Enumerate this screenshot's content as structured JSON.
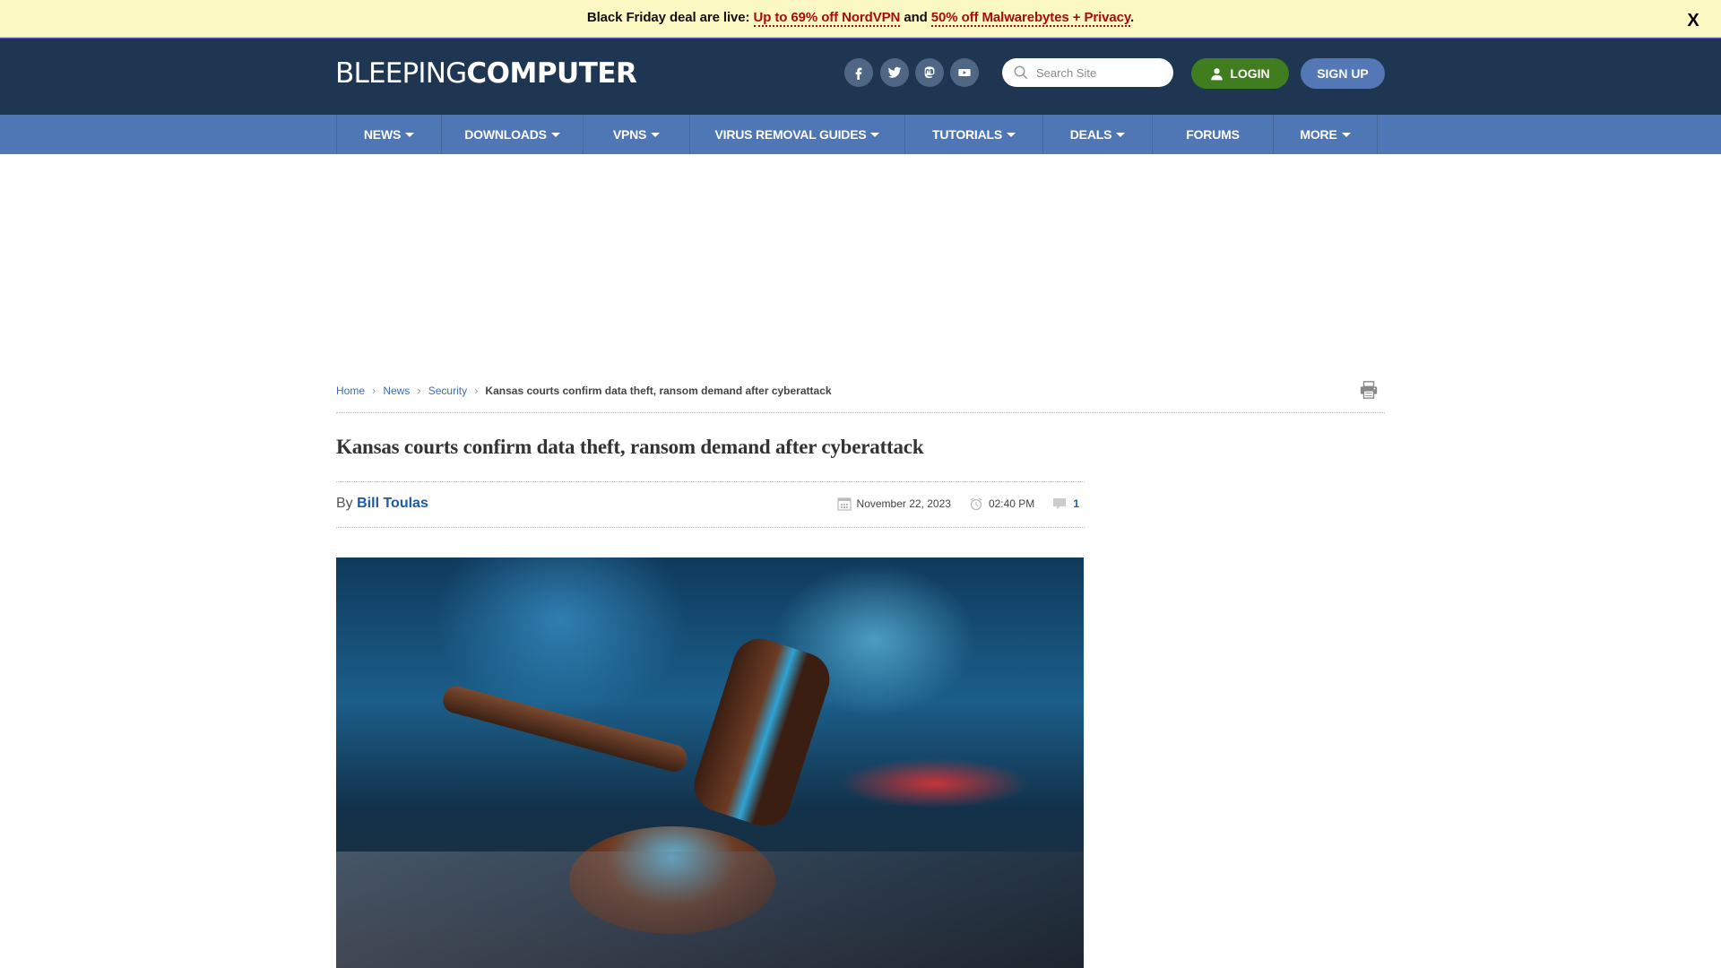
{
  "promo": {
    "lead": "Black Friday deal are live: ",
    "link1": "Up to 69% off NordVPN",
    "middle": " and ",
    "link2": "50% off Malwarebytes + Privacy",
    "trail": ".",
    "close_label": "X"
  },
  "header": {
    "logo_thin": "BLEEPING",
    "logo_bold": "COMPUTER",
    "social": [
      "facebook",
      "twitter",
      "mastodon",
      "youtube"
    ],
    "search_placeholder": "Search Site",
    "login_label": "LOGIN",
    "signup_label": "SIGN UP"
  },
  "nav": {
    "items": [
      {
        "label": "NEWS",
        "dropdown": true
      },
      {
        "label": "DOWNLOADS",
        "dropdown": true
      },
      {
        "label": "VPNS",
        "dropdown": true
      },
      {
        "label": "VIRUS REMOVAL GUIDES",
        "dropdown": true
      },
      {
        "label": "TUTORIALS",
        "dropdown": true
      },
      {
        "label": "DEALS",
        "dropdown": true
      },
      {
        "label": "FORUMS",
        "dropdown": false
      },
      {
        "label": "MORE",
        "dropdown": true
      }
    ]
  },
  "breadcrumb": {
    "items": [
      "Home",
      "News",
      "Security"
    ],
    "current": "Kansas courts confirm data theft, ransom demand after cyberattack"
  },
  "article": {
    "title": "Kansas courts confirm data theft, ransom demand after cyberattack",
    "by_label": "By ",
    "author": "Bill Toulas",
    "date": "November 22, 2023",
    "time": "02:40 PM",
    "comments": "1",
    "hero_alt": "Gavel striking shattered surface"
  }
}
